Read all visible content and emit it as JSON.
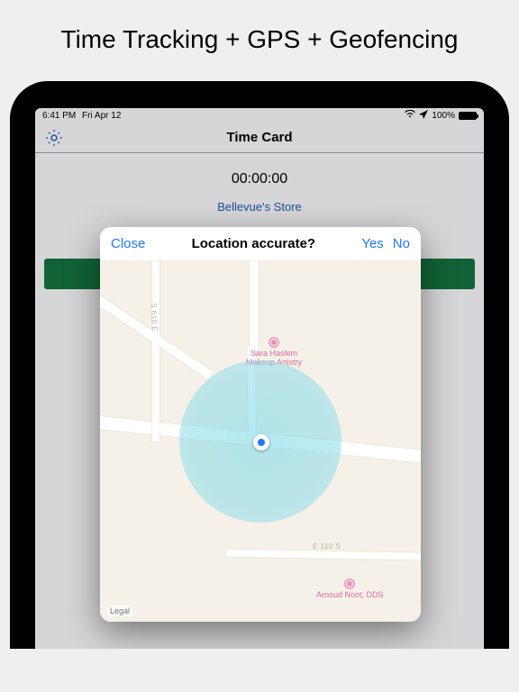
{
  "marketing_title": "Time Tracking + GPS + Geofencing",
  "statusbar": {
    "time": "6:41 PM",
    "date": "Fri Apr 12",
    "battery_pct": "100%"
  },
  "nav": {
    "title": "Time Card"
  },
  "page": {
    "timer": "00:00:00",
    "store_name": "Bellevue's Store"
  },
  "modal": {
    "close": "Close",
    "title": "Location accurate?",
    "yes": "Yes",
    "no": "No",
    "legal": "Legal"
  },
  "map": {
    "poi1": "Sara Haslem\nMakeup Artistry",
    "poi2": "Arnoud Noot, DDS",
    "street1": "S 610 E",
    "street2": "E 110 S"
  }
}
